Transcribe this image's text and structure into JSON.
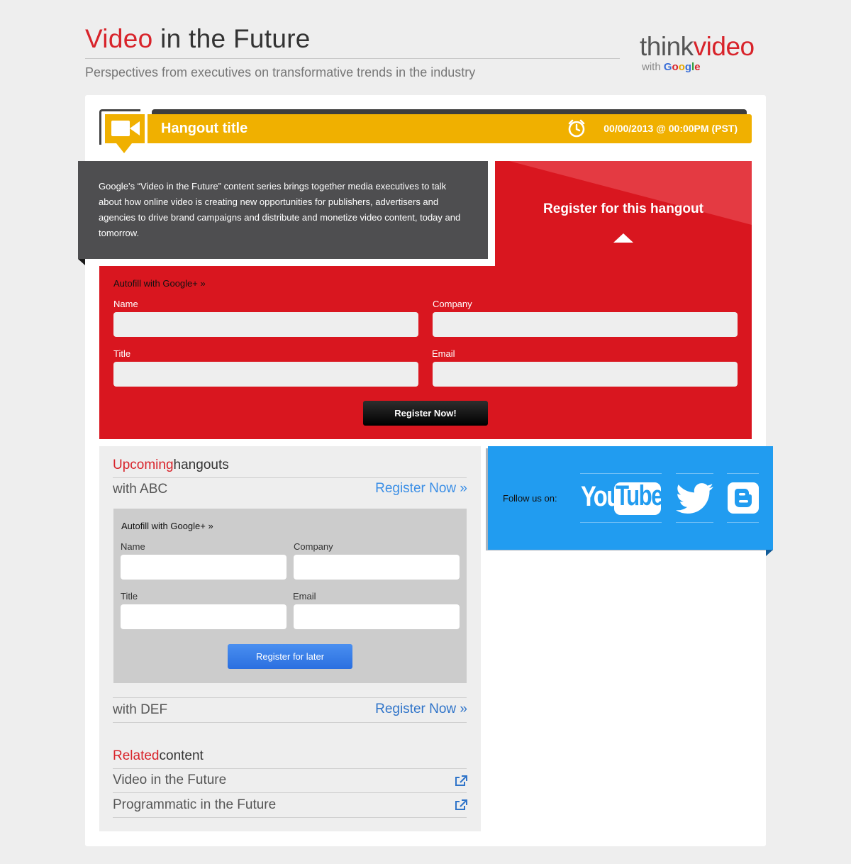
{
  "header": {
    "title_accent": "Video",
    "title_rest": "in the Future",
    "subtitle": "Perspectives from executives on transformative trends in the industry",
    "logo_think": "think",
    "logo_video": "video",
    "logo_with": "with",
    "logo_google": "Google"
  },
  "hangout": {
    "title": "Hangout title",
    "datetime": "00/00/2013 @ 00:00PM (PST)",
    "description": "Google’s “Video in the Future” content series brings together media executives to talk about how online video is creating new opportunities for publishers, advertisers and agencies to drive brand campaigns and distribute and monetize video content, today and tomorrow."
  },
  "register": {
    "heading": "Register for this hangout",
    "autofill": "Autofill with Google+  »",
    "name_label": "Name",
    "company_label": "Company",
    "title_label": "Title",
    "email_label": "Email",
    "name_value": "",
    "company_value": "",
    "title_value": "",
    "email_value": "",
    "submit": "Register Now!"
  },
  "upcoming": {
    "heading_accent": "Upcoming",
    "heading_rest": "hangouts",
    "items": [
      {
        "name": "with ABC",
        "link": "Register Now »"
      },
      {
        "name": "with DEF",
        "link": "Register Now »"
      }
    ],
    "form": {
      "autofill": "Autofill with Google+  »",
      "name_label": "Name",
      "company_label": "Company",
      "title_label": "Title",
      "email_label": "Email",
      "name_value": "",
      "company_value": "",
      "title_value": "",
      "email_value": "",
      "submit": "Register for later"
    }
  },
  "related": {
    "heading_accent": "Related",
    "heading_rest": "content",
    "items": [
      {
        "label": "Video in the Future",
        "icon": "external-link-icon"
      },
      {
        "label": "Programmatic in the Future",
        "icon": "external-link-icon"
      }
    ]
  },
  "follow": {
    "label": "Follow us on:",
    "youtube_you": "You",
    "youtube_tube": "Tube",
    "networks": [
      "youtube-icon",
      "twitter-icon",
      "blogger-icon"
    ]
  },
  "colors": {
    "brand_red": "#d9161f",
    "accent_yellow": "#f0b000",
    "follow_blue": "#219cf0",
    "link_blue": "#3a8ee6",
    "button_blue": "#2a6fe0"
  }
}
